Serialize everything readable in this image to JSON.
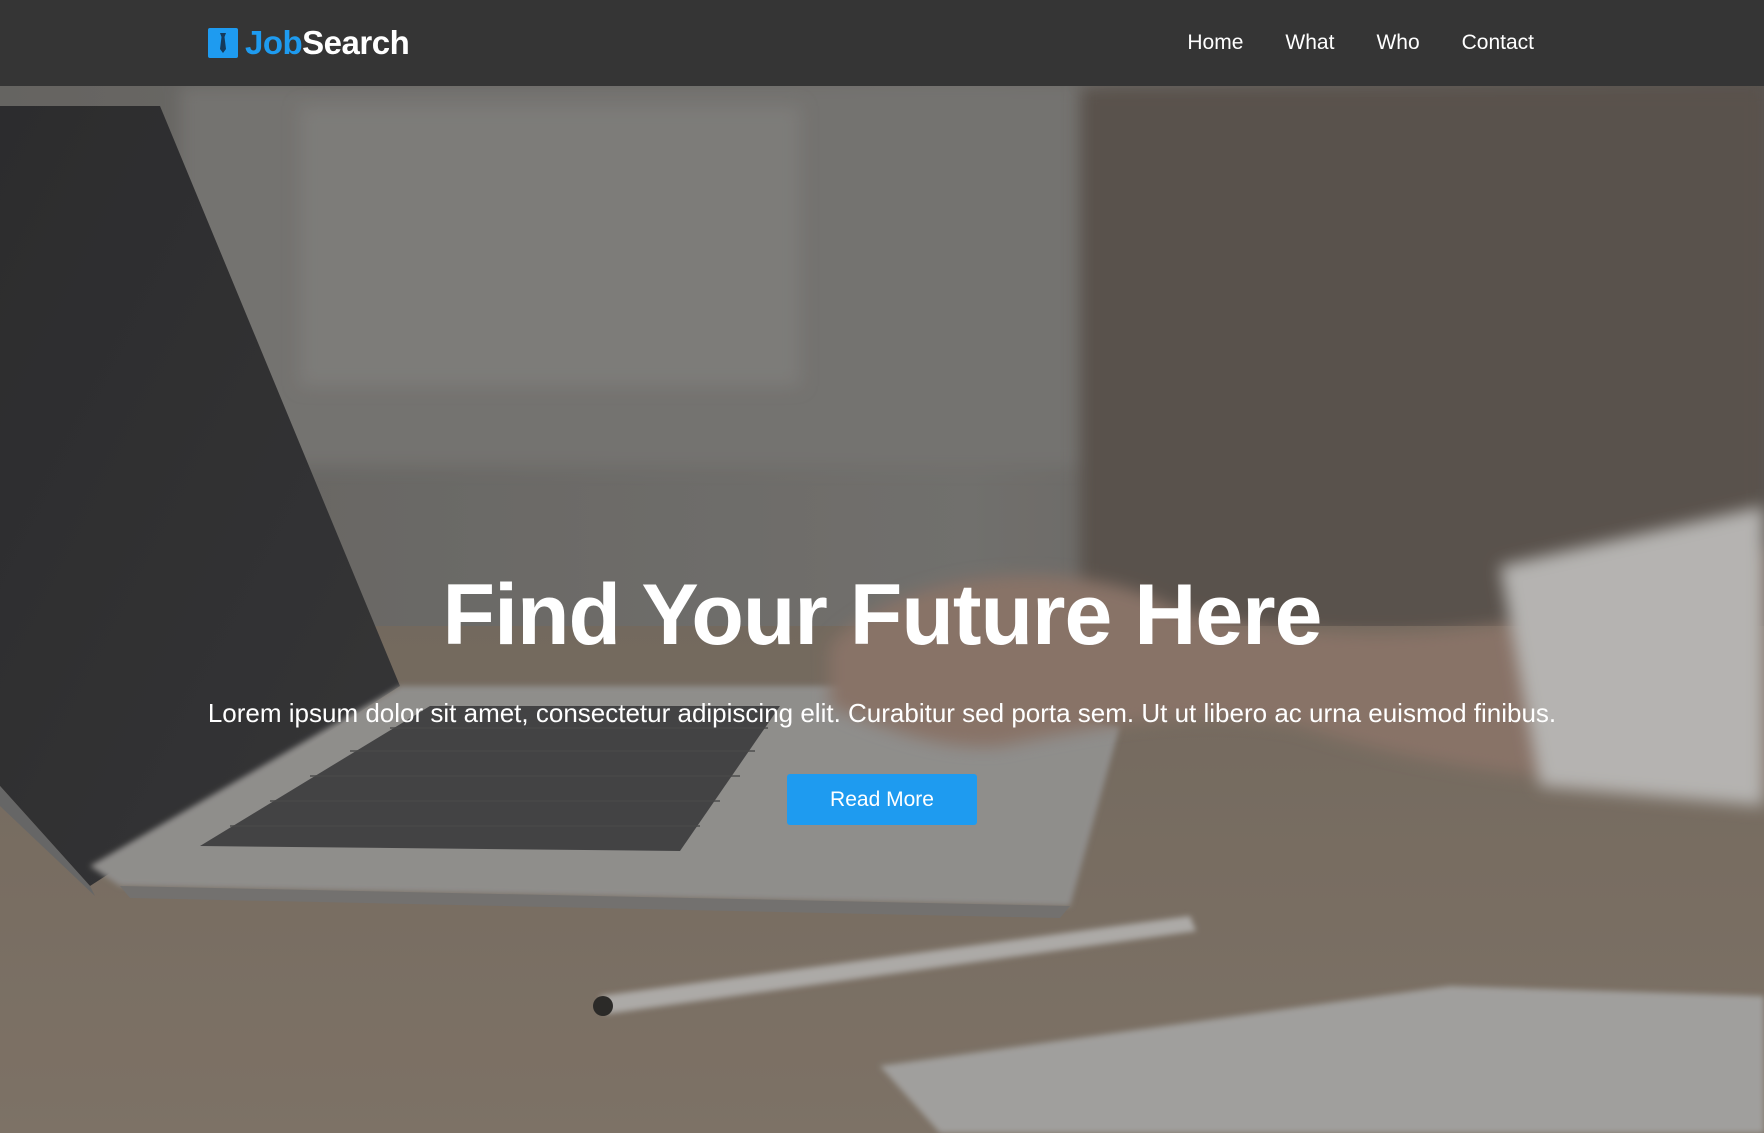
{
  "brand": {
    "part1": "Job",
    "part2": "Search",
    "icon": "tie-icon",
    "accent_color": "#1e9bf0"
  },
  "nav": {
    "items": [
      {
        "label": "Home"
      },
      {
        "label": "What"
      },
      {
        "label": "Who"
      },
      {
        "label": "Contact"
      }
    ]
  },
  "hero": {
    "title": "Find Your Future Here",
    "text": "Lorem ipsum dolor sit amet, consectetur adipiscing elit. Curabitur sed porta sem. Ut ut libero ac urna euismod finibus.",
    "button_label": "Read More",
    "background": "laptop-desk-photo"
  }
}
